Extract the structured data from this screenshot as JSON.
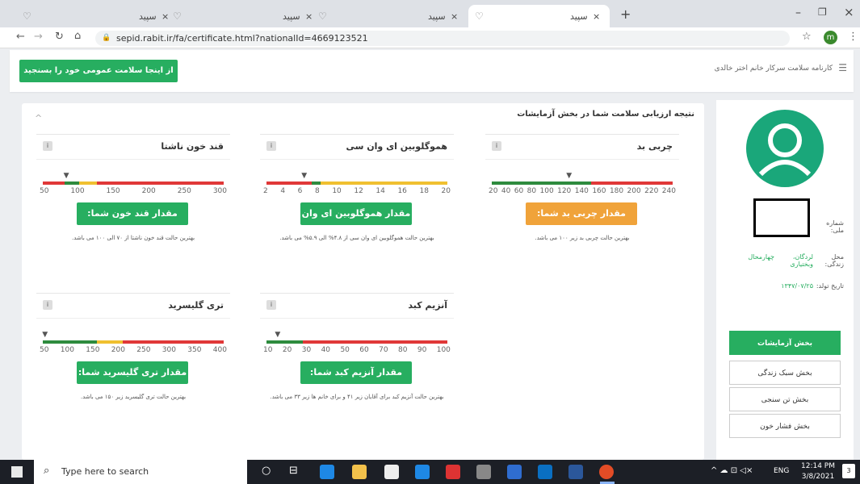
{
  "browser": {
    "tabs": [
      {
        "label": "سپید",
        "active": false
      },
      {
        "label": "سپید",
        "active": false
      },
      {
        "label": "سپید",
        "active": true
      },
      {
        "label": "سپید",
        "active": false
      }
    ],
    "new_tab": "+",
    "url": "sepid.rabit.ir/fa/certificate.html?nationalId=4669123521",
    "profile_initial": "m"
  },
  "header": {
    "menu_icon": "hamburger-icon",
    "title": "کارنامه سلامت سرکار خانم اختر خالدی",
    "cta": "از اینجا سلامت عمومی خود را بسنجید"
  },
  "section": {
    "title": "نتیجه ارزیابی سلامت شما در بخش آزمایشات",
    "collapse": "^"
  },
  "cards": [
    {
      "title": "چربی بد",
      "info": "i",
      "ticks": [
        "20",
        "40",
        "60",
        "80",
        "100",
        "120",
        "140",
        "160",
        "180",
        "200",
        "220",
        "240"
      ],
      "value_label": "مقدار چربی بد شما: ۱۱۴.۵",
      "note": "بهترین حالت چربی بد زیر ۱۰۰ می باشد.",
      "color": "#f0a33a",
      "reading": 114.5,
      "range": [
        20,
        240
      ]
    },
    {
      "title": "هموگلوبین ای وان سی",
      "info": "i",
      "ticks": [
        "2",
        "4",
        "6",
        "8",
        "10",
        "12",
        "14",
        "16",
        "18",
        "20"
      ],
      "value_label": "مقدار هموگلوبین ای وان سی شما: ۵.۸%",
      "note": "بهترین حالت هموگلوبین ای وان سی از ۴.۸% الی ۵.۹% می باشد.",
      "color": "#27ae60",
      "reading": 5.8,
      "range": [
        2,
        20
      ]
    },
    {
      "title": "قند خون ناشتا",
      "info": "i",
      "ticks": [
        "50",
        "100",
        "150",
        "200",
        "250",
        "300"
      ],
      "value_label": "مقدار قند خون شما: ۸۳.۰",
      "note": "بهترین حالت قند خون ناشتا از ۷۰ الی ۱۰۰ می باشد.",
      "color": "#27ae60",
      "reading": 83.0,
      "range": [
        50,
        300
      ]
    },
    {
      "title": "آنزیم کبد",
      "info": "i",
      "ticks": [
        "10",
        "20",
        "30",
        "40",
        "50",
        "60",
        "70",
        "80",
        "90",
        "100"
      ],
      "value_label": "مقدار آنزیم کبد شما: ۱۵.۸",
      "note": "بهترین حالت آنزیم کبد برای آقایان زیر ۴۱ و برای خانم ها زیر ۳۳ می باشد.",
      "color": "#27ae60",
      "reading": 15.8,
      "range": [
        10,
        100
      ]
    },
    {
      "title": "تری گلیسرید",
      "info": "i",
      "ticks": [
        "50",
        "100",
        "150",
        "200",
        "250",
        "300",
        "350",
        "400"
      ],
      "value_label": "مقدار تری گلیسرید شما: ۵۵.۰",
      "note": "بهترین حالت تری گلیسرید زیر ۱۵۰ می باشد.",
      "color": "#27ae60",
      "reading": 55.0,
      "range": [
        50,
        400
      ]
    }
  ],
  "profile": {
    "national_id_label": "شماره ملی:",
    "location_label": "محل زندگی:",
    "location_value_1": "چهارمحال",
    "location_value_2": "لردگان، وبختیاری",
    "birth_label": "تاریخ تولد:",
    "birth_value": "۱۳۴۷/۰۷/۲۵"
  },
  "side_menu": [
    {
      "label": "بخش آزمایشات",
      "active": true
    },
    {
      "label": "بخش سبک زندگی",
      "active": false
    },
    {
      "label": "بخش تن سنجی",
      "active": false
    },
    {
      "label": "بخش فشار خون",
      "active": false
    }
  ],
  "taskbar": {
    "search_placeholder": "Type here to search",
    "lang": "ENG",
    "time": "12:14 PM",
    "date": "3/8/2021",
    "notif_count": "3"
  }
}
